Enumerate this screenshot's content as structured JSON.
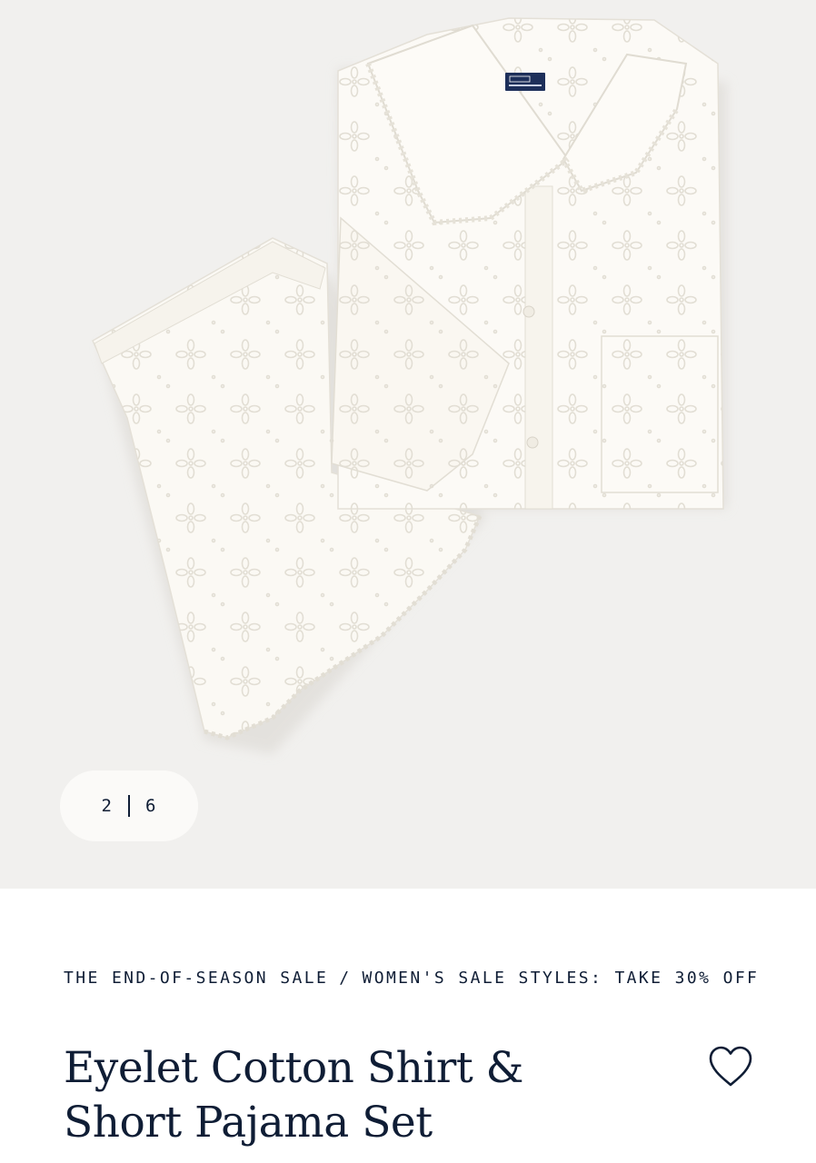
{
  "gallery": {
    "current": "2",
    "total": "6",
    "product_image": "eyelet-pajama-set-photo",
    "background": "#f1f0ee"
  },
  "breadcrumb": {
    "parent": "THE END-OF-SEASON SALE",
    "separator": "/",
    "current": "WOMEN'S SALE STYLES: TAKE 30% OFF"
  },
  "product": {
    "title": "Eyelet Cotton Shirt & Short Pajama Set",
    "wishlist_icon": "heart-outline-icon"
  },
  "colors": {
    "navy": "#0f1d35",
    "garment": "#fbf9f4"
  }
}
